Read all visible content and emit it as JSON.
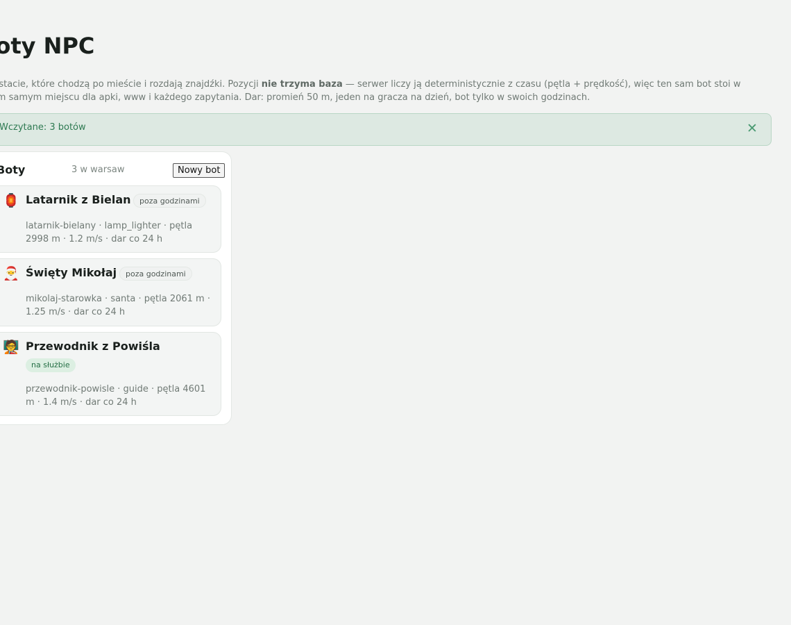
{
  "page": {
    "title": "Boty NPC",
    "description_before": "Postacie, które chodzą po mieście i rozdają znajdźki. Pozycji ",
    "description_bold": "nie trzyma baza",
    "description_after": " — serwer liczy ją deterministycznie z czasu (pętla + prędkość), więc ten sam bot stoi w tym samym miejscu dla apki, www i każdego zapytania. Dar: promień 50 m, jeden na gracza na dzień, bot tylko w swoich godzinach."
  },
  "alert": {
    "text": "Wczytane: 3 botów",
    "close_glyph": "✕"
  },
  "panel": {
    "title": "Boty",
    "count": "3 w warsaw",
    "new_button": "Nowy bot"
  },
  "bots": [
    {
      "icon": "lantern-icon",
      "emoji": "🏮",
      "name": "Latarnik z Bielan",
      "status": "poza godzinami",
      "on_duty": false,
      "meta": "latarnik-bielany · lamp_lighter · pętla 2998 m · 1.2 m/s · dar co 24 h"
    },
    {
      "icon": "santa-icon",
      "emoji": "🎅",
      "name": "Święty Mikołaj",
      "status": "poza godzinami",
      "on_duty": false,
      "meta": "mikolaj-starowka · santa · pętla 2061 m · 1.25 m/s · dar co 24 h"
    },
    {
      "icon": "guide-icon",
      "emoji": "🧑‍🏫",
      "name": "Przewodnik z Powiśla",
      "status": "na służbie",
      "on_duty": true,
      "meta": "przewodnik-powisle · guide · pętla 4601 m · 1.4 m/s · dar co 24 h"
    }
  ],
  "colors": {
    "background": "#f2f3f2",
    "alert_background": "#dde9e2",
    "alert_text": "#2e7a52",
    "on_duty_badge": "#dcefe2"
  }
}
